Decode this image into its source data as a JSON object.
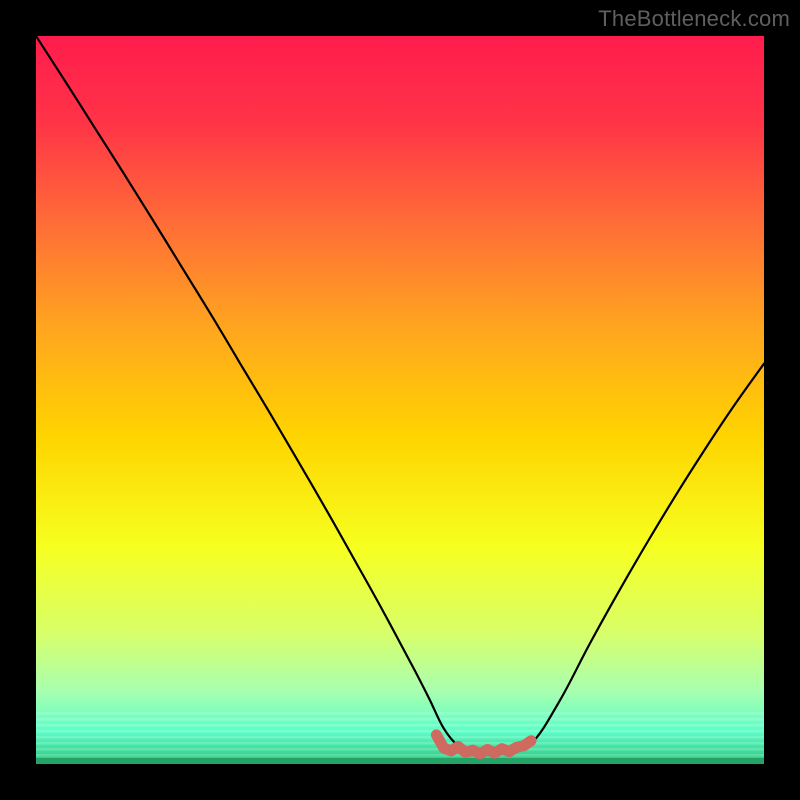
{
  "watermark": "TheBottleneck.com",
  "chart_data": {
    "type": "line",
    "title": "",
    "xlabel": "",
    "ylabel": "",
    "xlim": [
      0,
      100
    ],
    "ylim": [
      0,
      100
    ],
    "background": {
      "type": "vertical-gradient",
      "stops": [
        {
          "offset": 0.0,
          "color": "#ff1c4d"
        },
        {
          "offset": 0.12,
          "color": "#ff3447"
        },
        {
          "offset": 0.25,
          "color": "#ff6a38"
        },
        {
          "offset": 0.4,
          "color": "#ffa51f"
        },
        {
          "offset": 0.55,
          "color": "#ffd400"
        },
        {
          "offset": 0.7,
          "color": "#f6ff1f"
        },
        {
          "offset": 0.82,
          "color": "#d8ff6a"
        },
        {
          "offset": 0.9,
          "color": "#a8ffb0"
        },
        {
          "offset": 0.955,
          "color": "#5cffc8"
        },
        {
          "offset": 1.0,
          "color": "#2cc57c"
        }
      ]
    },
    "series": [
      {
        "name": "bottleneck-curve",
        "color": "#000000",
        "stroke_width": 2.2,
        "x": [
          0,
          4,
          8,
          12,
          16,
          20,
          24,
          28,
          32,
          36,
          40,
          44,
          48,
          52,
          54,
          56,
          58,
          60,
          62,
          64,
          68,
          72,
          76,
          80,
          84,
          88,
          92,
          96,
          100
        ],
        "y": [
          100,
          93.8,
          87.5,
          81.2,
          74.8,
          68.3,
          61.8,
          55.1,
          48.4,
          41.6,
          34.7,
          27.6,
          20.4,
          12.9,
          9.0,
          4.9,
          2.5,
          1.6,
          1.3,
          1.4,
          2.8,
          8.8,
          16.4,
          23.6,
          30.5,
          37.1,
          43.4,
          49.4,
          55.0
        ]
      },
      {
        "name": "optimal-zone-marker",
        "color": "#cf6a60",
        "stroke_width": 11,
        "style": "squiggle",
        "x": [
          55,
          56,
          57,
          58,
          59,
          60,
          61,
          62,
          63,
          64,
          65,
          66,
          67,
          68
        ],
        "y": [
          4.0,
          2.2,
          1.8,
          2.4,
          1.6,
          1.9,
          1.4,
          2.0,
          1.5,
          2.1,
          1.7,
          2.3,
          2.5,
          3.2
        ]
      }
    ]
  }
}
